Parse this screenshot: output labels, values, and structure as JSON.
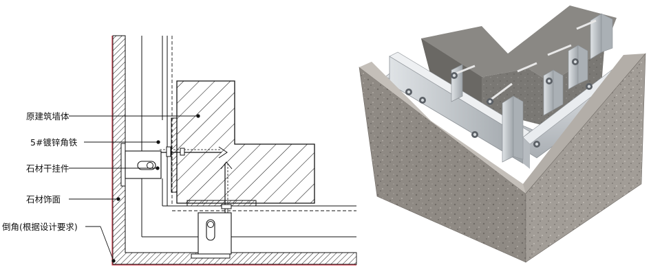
{
  "labels": {
    "wall": "原建筑墙体",
    "angle_steel": "5#镀锌角铁",
    "pendant": "石材干挂件",
    "stone_facing": "石材饰面",
    "chamfer": "倒角(根据设计要求)"
  },
  "colors": {
    "line": "#111111",
    "red_edge": "#d83a4a",
    "concrete": "#7d7d7a",
    "metal": "#c9cdd1",
    "stone": "#9a958f"
  },
  "icons": {
    "anchor_bolt": "bolt-icon",
    "slot_hole": "slot-icon"
  }
}
